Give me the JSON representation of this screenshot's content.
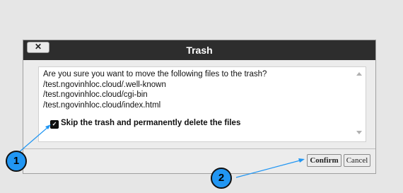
{
  "dialog": {
    "title": "Trash",
    "close_icon": "close-x-icon",
    "close_label": "✕",
    "message": "Are you sure you want to move the following files to the trash?",
    "files": [
      "/test.ngovinhloc.cloud/.well-known",
      "/test.ngovinhloc.cloud/cgi-bin",
      "/test.ngovinhloc.cloud/index.html"
    ],
    "skip_trash_label": "Skip the trash and permanently delete the files",
    "skip_trash_checked": true,
    "confirm_label": "Confirm",
    "cancel_label": "Cancel"
  },
  "annotations": [
    {
      "label": "1"
    },
    {
      "label": "2"
    }
  ],
  "colors": {
    "titlebar": "#2d2d2d",
    "marker": "#2196f3"
  }
}
